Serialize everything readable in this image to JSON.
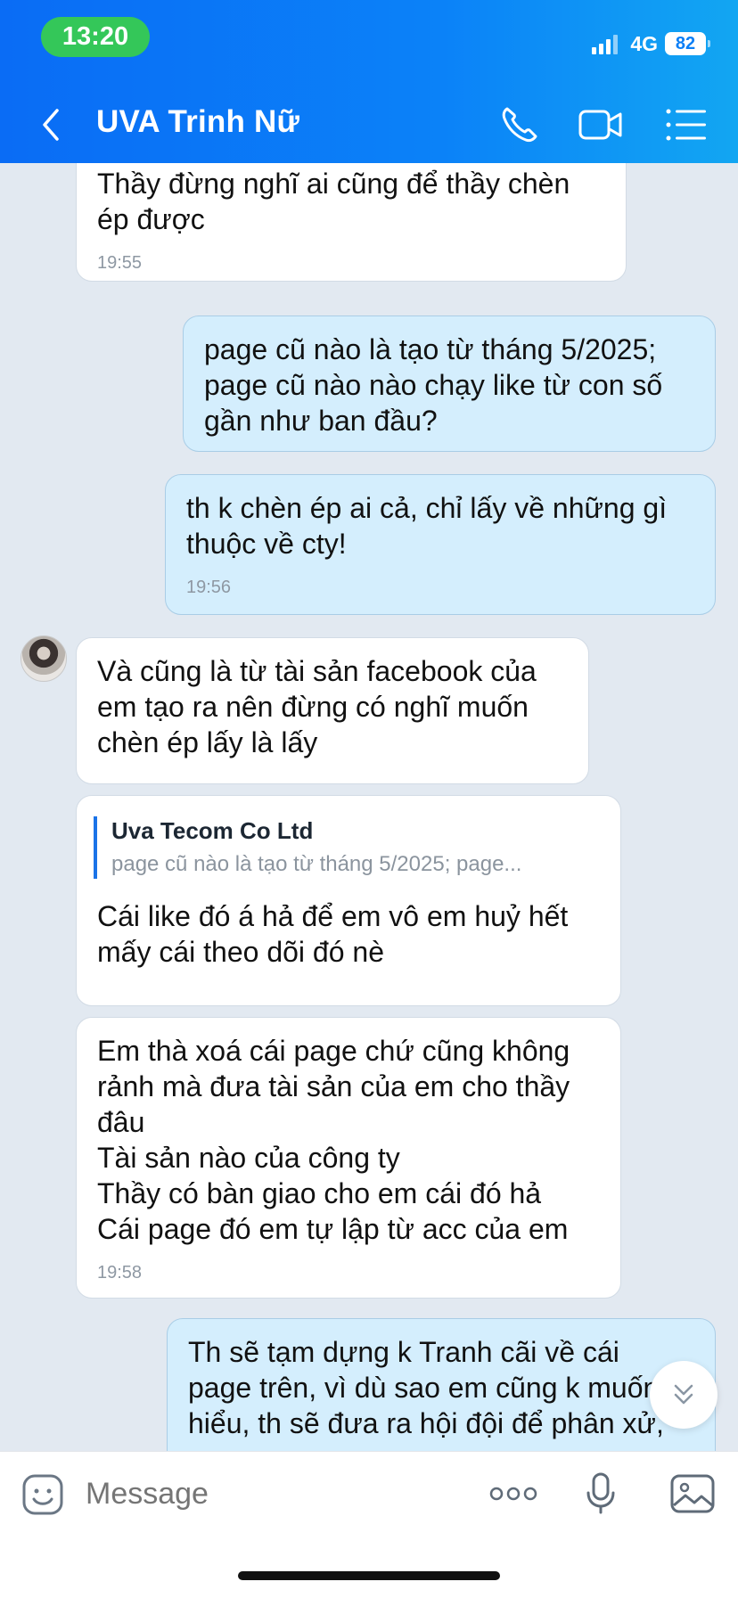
{
  "status_bar": {
    "time": "13:20",
    "network": "4G",
    "battery": "82"
  },
  "header": {
    "title": "UVA Trinh Nữ"
  },
  "messages": [
    {
      "direction": "incoming",
      "text": "Thầy đừng nghĩ ai cũng để thầy chèn\nép được",
      "time": "19:55"
    },
    {
      "direction": "outgoing",
      "text": "page cũ nào là tạo từ tháng 5/2025;\npage cũ nào nào chạy like từ con số\ngần như ban đầu?"
    },
    {
      "direction": "outgoing",
      "text": "th k chèn ép ai cả, chỉ lấy về những gì\nthuộc về cty!",
      "time": "19:56"
    },
    {
      "direction": "incoming",
      "text": "Và cũng là từ tài sản facebook của\nem tạo ra nên đừng có nghĩ muốn\nchèn ép lấy là lấy"
    },
    {
      "direction": "incoming",
      "quote": {
        "name": "Uva Tecom Co Ltd",
        "text": "page cũ nào là tạo từ tháng 5/2025; page..."
      },
      "text": "Cái like đó á hả để em vô em huỷ hết\nmấy cái theo dõi đó nè"
    },
    {
      "direction": "incoming",
      "text": "Em thà xoá cái page chứ cũng không\nrảnh mà đưa tài sản của em cho thầy\nđâu\nTài sản nào của công ty\nThầy có bàn giao cho em cái đó hả\nCái page đó em tự lập từ acc của em",
      "time": "19:58"
    },
    {
      "direction": "outgoing",
      "text": "Th sẽ tạm dựng k Tranh cãi về cái\npage trên, vì dù sao em cũng k muốn\nhiểu, th sẽ đưa ra hội đội để phân xử,"
    }
  ],
  "composer": {
    "placeholder": "Message"
  },
  "icons": {
    "back": "chevron-left-icon",
    "call": "phone-icon",
    "video": "video-camera-icon",
    "menu": "list-menu-icon",
    "sticker": "emoji-sticker-icon",
    "more": "more-dots-icon",
    "mic": "microphone-icon",
    "image": "image-gallery-icon",
    "scroll": "double-chevron-down-icon"
  },
  "colors": {
    "header": "#0b82f8",
    "status_pill": "#34c759",
    "incoming_bubble": "#ffffff",
    "outgoing_bubble": "#d4eefd",
    "chat_background": "#e2e9f1",
    "quote_bar": "#1a73e8"
  }
}
